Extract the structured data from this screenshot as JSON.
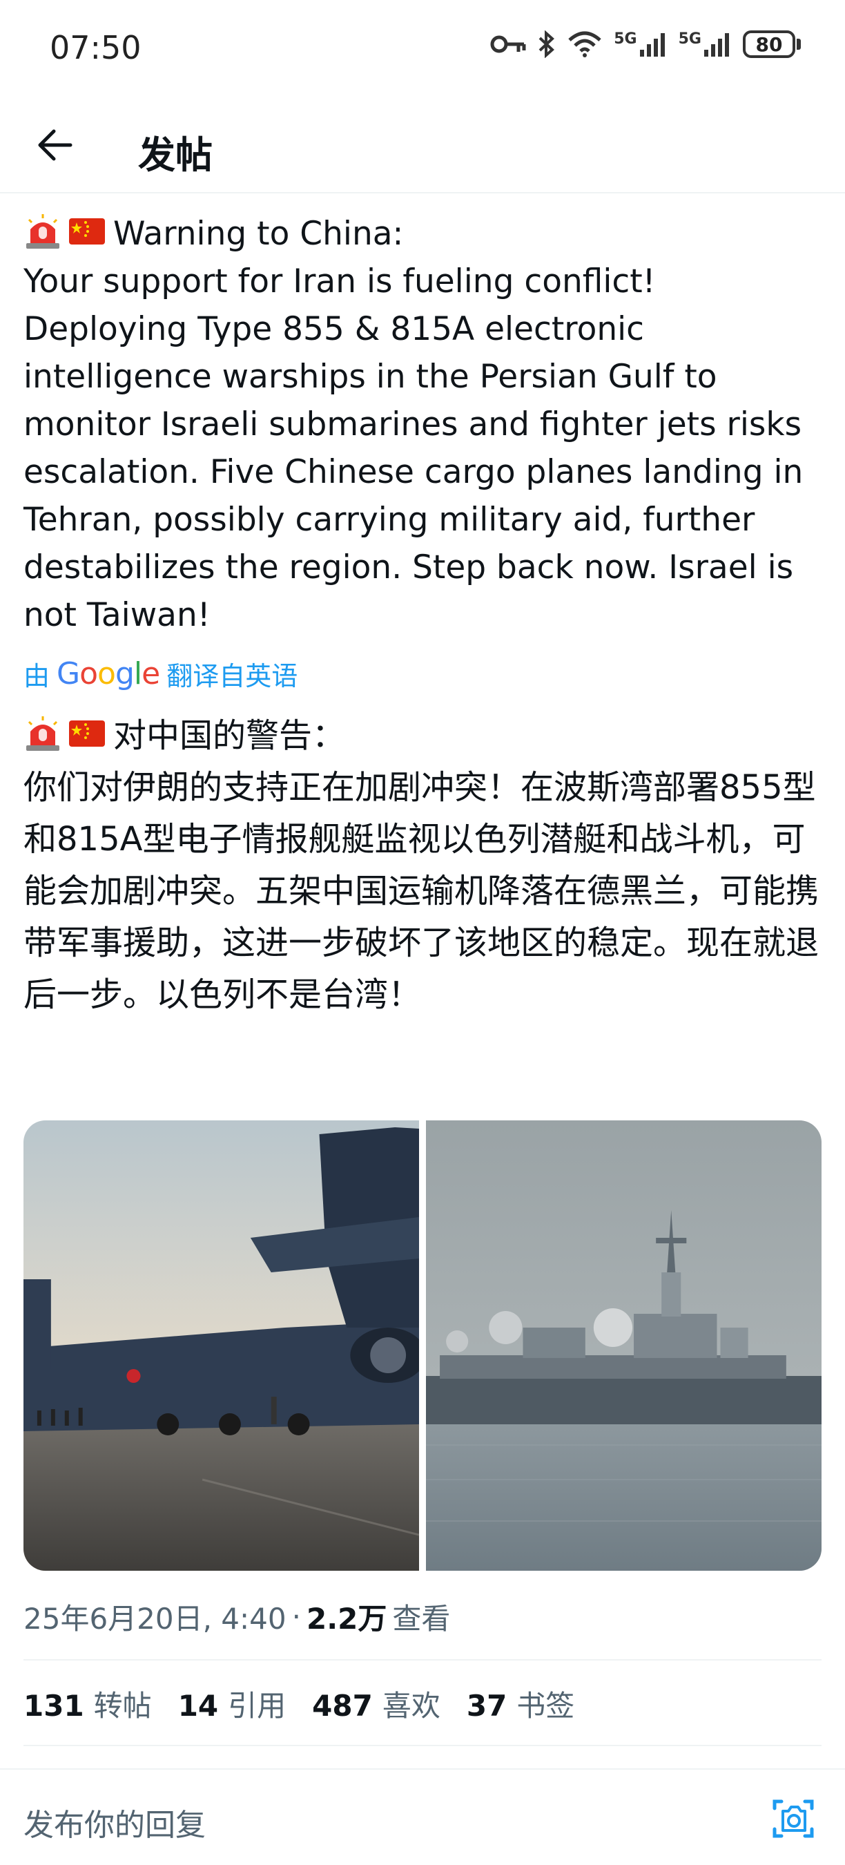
{
  "status_bar": {
    "time": "07:50",
    "battery": "80",
    "net1": "5G",
    "net2": "5G",
    "icons": [
      "key-icon",
      "bluetooth-icon",
      "wifi-icon",
      "signal-icon",
      "signal-icon",
      "battery-icon"
    ]
  },
  "header": {
    "back_icon": "arrow-left-icon",
    "title": "发帖"
  },
  "post": {
    "text_en": "Warning to China:\nYour support for Iran is fueling conflict! Deploying Type 855 & 815A electronic intelligence warships in the Persian Gulf to monitor Israeli submarines and fighter jets risks escalation. Five Chinese cargo planes landing in Tehran, possibly carrying military aid, further destabilizes the region. Step back now. Israel is not Taiwan!",
    "translate_prefix": "由",
    "translate_brand": "Google",
    "translate_suffix": "翻译自英语",
    "text_zh": "对中国的警告：\n你们对伊朗的支持正在加剧冲突！在波斯湾部署855型和815A型电子情报舰艇监视以色列潜艇和战斗机，可能会加剧冲突。五架中国运输机降落在德黑兰，可能携带军事援助，这进一步破坏了该地区的稳定。现在就退后一步。以色列不是台湾！",
    "emojis": [
      "siren-emoji",
      "china-flag-emoji"
    ],
    "images": [
      "cargo-plane-photo",
      "warship-photo"
    ],
    "timestamp": "25年6月20日, 4:40",
    "meta_sep": "·",
    "views_count": "2.2万",
    "views_label": "查看"
  },
  "stats": [
    {
      "count": "131",
      "label": "转帖"
    },
    {
      "count": "14",
      "label": "引用"
    },
    {
      "count": "487",
      "label": "喜欢"
    },
    {
      "count": "37",
      "label": "书签"
    }
  ],
  "reply": {
    "placeholder": "发布你的回复",
    "camera_icon": "camera-icon"
  },
  "colors": {
    "link": "#1d9bf0",
    "text": "#0f1419",
    "secondary": "#536471"
  }
}
